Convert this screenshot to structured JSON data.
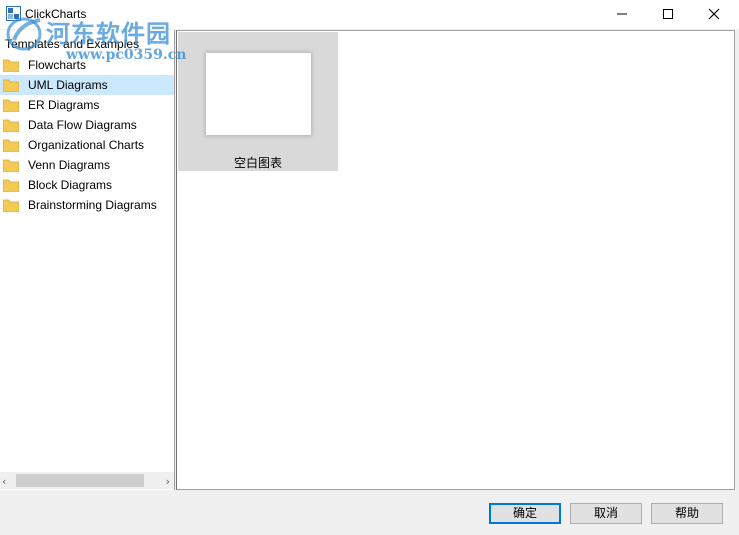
{
  "window": {
    "title": "ClickCharts",
    "app_icon": "clickcharts-app-icon",
    "controls": {
      "minimize": "minimize-icon",
      "maximize": "maximize-icon",
      "close": "close-icon"
    }
  },
  "watermark": {
    "text_cn": "河东软件园",
    "url": "www.pc0359.cn"
  },
  "sidebar": {
    "header": "Templates and Examples",
    "items": [
      {
        "label": "Flowcharts",
        "icon": "folder-icon"
      },
      {
        "label": "UML Diagrams",
        "icon": "folder-icon",
        "selected": true
      },
      {
        "label": "ER Diagrams",
        "icon": "folder-icon"
      },
      {
        "label": "Data Flow Diagrams",
        "icon": "folder-icon"
      },
      {
        "label": "Organizational Charts",
        "icon": "folder-icon"
      },
      {
        "label": "Venn Diagrams",
        "icon": "folder-icon"
      },
      {
        "label": "Block Diagrams",
        "icon": "folder-icon"
      },
      {
        "label": "Brainstorming Diagrams",
        "icon": "folder-icon"
      }
    ],
    "scrollbar": {
      "left_arrow": "‹",
      "right_arrow": "›"
    }
  },
  "main": {
    "templates": [
      {
        "label": "空白图表"
      }
    ]
  },
  "buttons": {
    "ok": "确定",
    "cancel": "取消",
    "help": "帮助"
  },
  "colors": {
    "selection": "#cce8ff",
    "default_button_border": "#0078d7",
    "folder": "#f5c956"
  }
}
